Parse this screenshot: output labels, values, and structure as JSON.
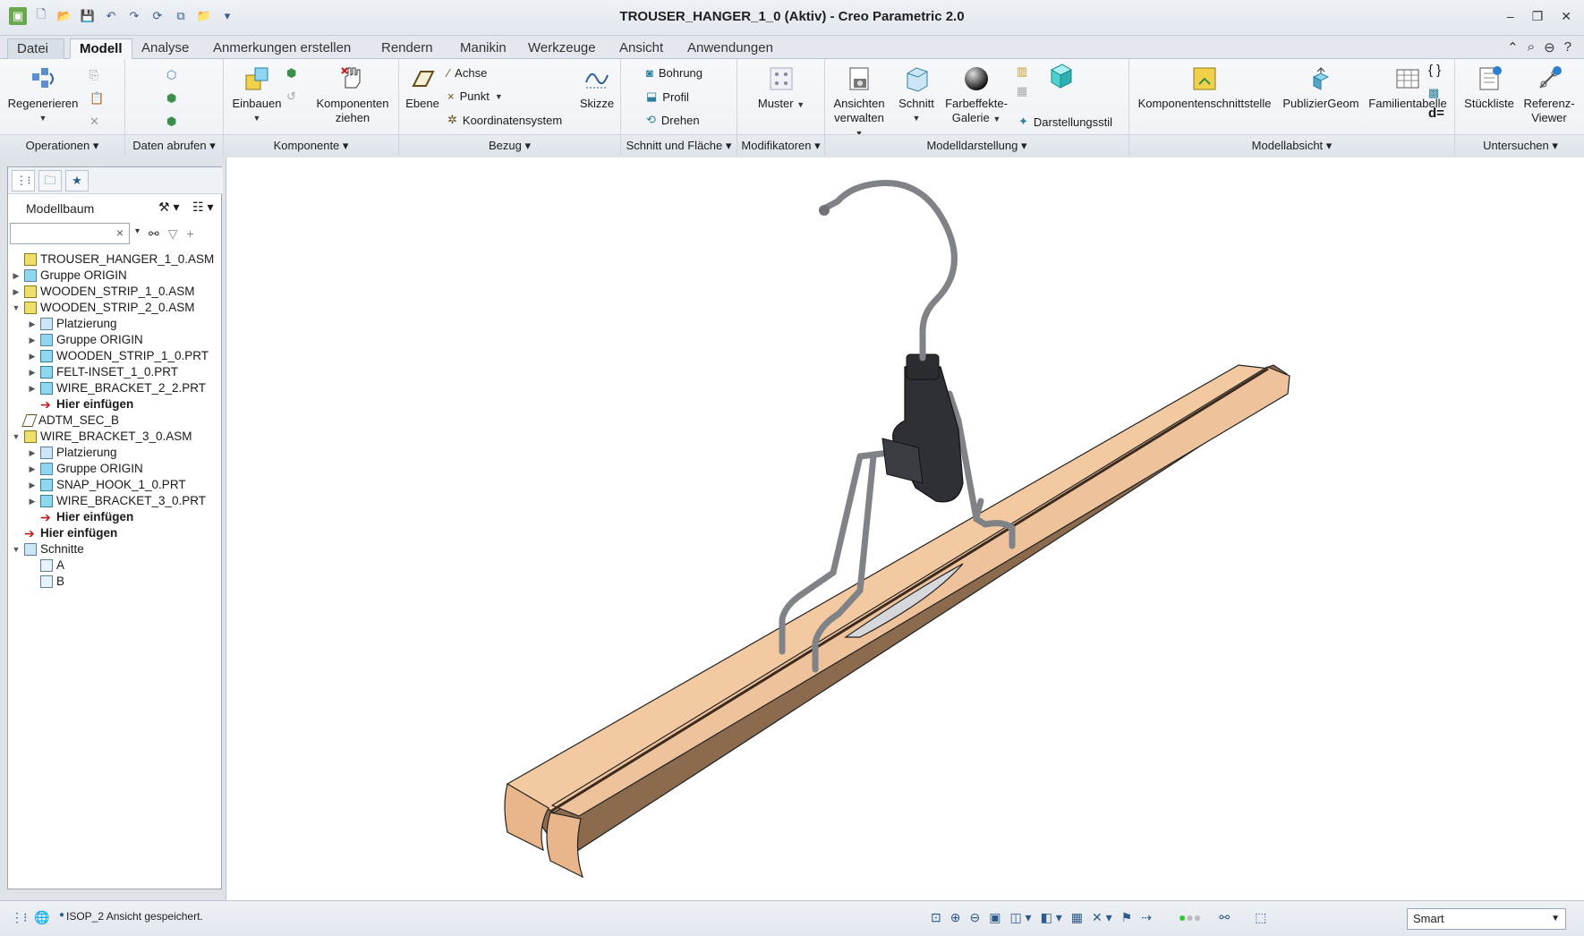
{
  "window": {
    "title": "TROUSER_HANGER_1_0 (Aktiv) - Creo Parametric 2.0",
    "controls": [
      "–",
      "❐",
      "✕"
    ]
  },
  "tabs": {
    "file": "Datei",
    "items": [
      "Modell",
      "Analyse",
      "Anmerkungen erstellen",
      "Rendern",
      "Manikin",
      "Werkzeuge",
      "Ansicht",
      "Anwendungen"
    ]
  },
  "ribbon": {
    "operations": {
      "label": "Operationen",
      "regen": "Regenerieren"
    },
    "data": {
      "label": "Daten abrufen"
    },
    "component": {
      "label": "Komponente",
      "einbauen": "Einbauen",
      "komponenten": "Komponenten",
      "ziehen": "ziehen"
    },
    "datum": {
      "label": "Bezug",
      "ebene": "Ebene",
      "achse": "Achse",
      "punkt": "Punkt",
      "koord": "Koordinatensystem",
      "skizze": "Skizze"
    },
    "cut": {
      "label": "Schnitt und Fläche",
      "bohrung": "Bohrung",
      "profil": "Profil",
      "drehen": "Drehen"
    },
    "modifiers": {
      "label": "Modifikatoren",
      "muster": "Muster"
    },
    "display": {
      "label": "Modelldarstellung",
      "ansichten": "Ansichten",
      "verwalten": "verwalten",
      "schnitt": "Schnitt",
      "farbeffekte": "Farbeffekte-",
      "galerie": "Galerie",
      "darstellungsstil": "Darstellungsstil"
    },
    "intent": {
      "label": "Modellabsicht",
      "komponentenschnitt": "Komponentenschnittstelle",
      "publizier": "PublizierGeom",
      "familie": "Familientabelle",
      "d_eq": "d="
    },
    "investigate": {
      "label": "Untersuchen",
      "stueckliste": "Stückliste",
      "referenz": "Referenz-",
      "viewer": "Viewer"
    }
  },
  "model_tree": {
    "title": "Modellbaum",
    "search_placeholder": "",
    "items": [
      {
        "label": "TROUSER_HANGER_1_0.ASM",
        "level": 0,
        "arrow": "",
        "icon": "asm"
      },
      {
        "label": "Gruppe ORIGIN",
        "level": 0,
        "arrow": "▶",
        "icon": "group"
      },
      {
        "label": "WOODEN_STRIP_1_0.ASM",
        "level": 0,
        "arrow": "▶",
        "icon": "asm"
      },
      {
        "label": "WOODEN_STRIP_2_0.ASM",
        "level": 0,
        "arrow": "▼",
        "icon": "asm"
      },
      {
        "label": "Platzierung",
        "level": 1,
        "arrow": "▶",
        "icon": "place"
      },
      {
        "label": "Gruppe ORIGIN",
        "level": 1,
        "arrow": "▶",
        "icon": "group"
      },
      {
        "label": "WOODEN_STRIP_1_0.PRT",
        "level": 1,
        "arrow": "▶",
        "icon": "prt"
      },
      {
        "label": "FELT-INSET_1_0.PRT",
        "level": 1,
        "arrow": "▶",
        "icon": "prt"
      },
      {
        "label": "WIRE_BRACKET_2_2.PRT",
        "level": 1,
        "arrow": "▶",
        "icon": "prt"
      },
      {
        "label": "Hier einfügen",
        "level": 1,
        "arrow": "",
        "icon": "insert"
      },
      {
        "label": "ADTM_SEC_B",
        "level": 0,
        "arrow": "",
        "icon": "plane"
      },
      {
        "label": "WIRE_BRACKET_3_0.ASM",
        "level": 0,
        "arrow": "▼",
        "icon": "asm"
      },
      {
        "label": "Platzierung",
        "level": 1,
        "arrow": "▶",
        "icon": "place"
      },
      {
        "label": "Gruppe ORIGIN",
        "level": 1,
        "arrow": "▶",
        "icon": "group"
      },
      {
        "label": "SNAP_HOOK_1_0.PRT",
        "level": 1,
        "arrow": "▶",
        "icon": "prt"
      },
      {
        "label": "WIRE_BRACKET_3_0.PRT",
        "level": 1,
        "arrow": "▶",
        "icon": "prt"
      },
      {
        "label": "Hier einfügen",
        "level": 1,
        "arrow": "",
        "icon": "insert"
      },
      {
        "label": "Hier einfügen",
        "level": 0,
        "arrow": "",
        "icon": "insert"
      },
      {
        "label": "Schnitte",
        "level": 0,
        "arrow": "▼",
        "icon": "sections"
      },
      {
        "label": "A",
        "level": 1,
        "arrow": "",
        "icon": "section"
      },
      {
        "label": "B",
        "level": 1,
        "arrow": "",
        "icon": "section"
      }
    ]
  },
  "status": {
    "message": "ISOP_2 Ansicht gespeichert.",
    "filter": "Smart"
  },
  "colors": {
    "wood_top": "#f2c9a0",
    "wood_side": "#8c6a4e",
    "wood_end": "#e8b68a",
    "wire": "#8a8d92",
    "clip": "#2e3035"
  }
}
